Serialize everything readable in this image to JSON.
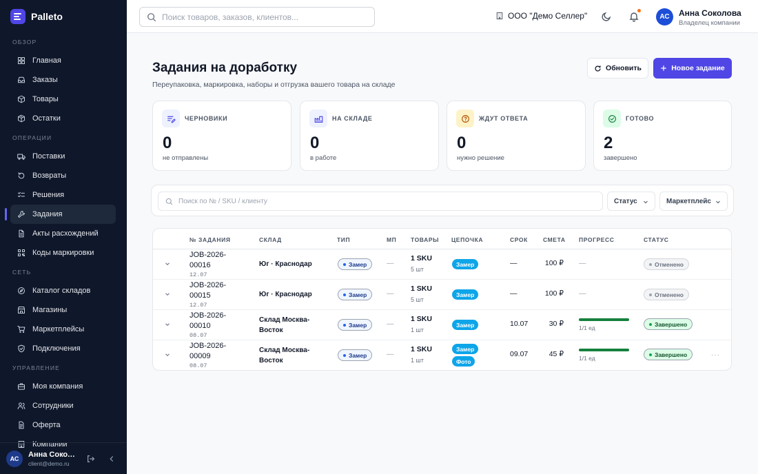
{
  "app": {
    "name": "Palleto"
  },
  "sidebar": {
    "sections": [
      {
        "title": "ОБЗОР",
        "items": [
          {
            "label": "Главная",
            "icon": "grid-icon"
          },
          {
            "label": "Заказы",
            "icon": "inbox-icon"
          },
          {
            "label": "Товары",
            "icon": "box-icon"
          },
          {
            "label": "Остатки",
            "icon": "stock-icon"
          }
        ]
      },
      {
        "title": "ОПЕРАЦИИ",
        "items": [
          {
            "label": "Поставки",
            "icon": "truck-icon"
          },
          {
            "label": "Возвраты",
            "icon": "return-icon"
          },
          {
            "label": "Решения",
            "icon": "checklist-icon"
          },
          {
            "label": "Задания",
            "icon": "wrench-icon",
            "active": true
          },
          {
            "label": "Акты расхождений",
            "icon": "file-icon"
          },
          {
            "label": "Коды маркировки",
            "icon": "qr-icon"
          }
        ]
      },
      {
        "title": "СЕТЬ",
        "items": [
          {
            "label": "Каталог складов",
            "icon": "compass-icon"
          },
          {
            "label": "Магазины",
            "icon": "store-icon"
          },
          {
            "label": "Маркетплейсы",
            "icon": "cart-icon"
          },
          {
            "label": "Подключения",
            "icon": "shield-icon"
          }
        ]
      },
      {
        "title": "УПРАВЛЕНИЕ",
        "items": [
          {
            "label": "Моя компания",
            "icon": "briefcase-icon"
          },
          {
            "label": "Сотрудники",
            "icon": "users-icon"
          },
          {
            "label": "Оферта",
            "icon": "document-icon"
          },
          {
            "label": "Компании",
            "icon": "building-icon"
          }
        ]
      }
    ],
    "footer": {
      "initials": "АС",
      "name": "Анна Соколова",
      "email": "client@demo.ru"
    }
  },
  "header": {
    "search_placeholder": "Поиск товаров, заказов, клиентов...",
    "company": "ООО \"Демо Селлер\"",
    "user": {
      "initials": "АС",
      "name": "Анна Соколова",
      "role": "Владелец компании"
    }
  },
  "page": {
    "title": "Задания на доработку",
    "subtitle": "Переупаковка, маркировка, наборы и отгрузка вашего товара на складе",
    "refresh_label": "Обновить",
    "new_label": "Новое задание"
  },
  "stats": [
    {
      "label": "ЧЕРНОВИКИ",
      "value": "0",
      "sub": "не отправлены",
      "icon": "draft-icon",
      "color": "#eef2ff",
      "accent": "#4f46e5"
    },
    {
      "label": "НА СКЛАДЕ",
      "value": "0",
      "sub": "в работе",
      "icon": "factory-icon",
      "color": "#eef2ff",
      "accent": "#4f46e5"
    },
    {
      "label": "ЖДУТ ОТВЕТА",
      "value": "0",
      "sub": "нужно решение",
      "icon": "question-icon",
      "color": "#fef3c7",
      "accent": "#b45309"
    },
    {
      "label": "ГОТОВО",
      "value": "2",
      "sub": "завершено",
      "icon": "check-circle-icon",
      "color": "#dcfce7",
      "accent": "#15803d"
    }
  ],
  "filters": {
    "search_placeholder": "Поиск по № / SKU / клиенту",
    "status_label": "Статус",
    "marketplace_label": "Маркетплейс"
  },
  "table": {
    "headers": [
      "№ ЗАДАНИЯ",
      "СКЛАД",
      "ТИП",
      "МП",
      "ТОВАРЫ",
      "ЦЕПОЧКА",
      "СРОК",
      "СМЕТА",
      "ПРОГРЕСС",
      "СТАТУС"
    ],
    "rows": [
      {
        "id_line1": "JOB-2026-",
        "id_line2": "00016",
        "date": "12.07",
        "warehouse": "Юг · Краснодар",
        "type": "Замер",
        "mp": "—",
        "sku": "1 SKU",
        "qty": "5 шт",
        "chain": [
          "Замер"
        ],
        "term": "—",
        "estimate": "100 ₽",
        "progress": null,
        "progress_text": "—",
        "status": "Отменено",
        "status_kind": "cancel"
      },
      {
        "id_line1": "JOB-2026-",
        "id_line2": "00015",
        "date": "12.07",
        "warehouse": "Юг · Краснодар",
        "type": "Замер",
        "mp": "—",
        "sku": "1 SKU",
        "qty": "5 шт",
        "chain": [
          "Замер"
        ],
        "term": "—",
        "estimate": "100 ₽",
        "progress": null,
        "progress_text": "—",
        "status": "Отменено",
        "status_kind": "cancel"
      },
      {
        "id_line1": "JOB-2026-",
        "id_line2": "00010",
        "date": "08.07",
        "warehouse": "Склад Москва-Восток",
        "type": "Замер",
        "mp": "—",
        "sku": "1 SKU",
        "qty": "1 шт",
        "chain": [
          "Замер"
        ],
        "term": "10.07",
        "estimate": "30 ₽",
        "progress": 1.0,
        "progress_text": "1/1 ед",
        "status": "Завершено",
        "status_kind": "done"
      },
      {
        "id_line1": "JOB-2026-",
        "id_line2": "00009",
        "date": "08.07",
        "warehouse": "Склад Москва-Восток",
        "type": "Замер",
        "mp": "—",
        "sku": "1 SKU",
        "qty": "1 шт",
        "chain": [
          "Замер",
          "Фото"
        ],
        "term": "09.07",
        "estimate": "45 ₽",
        "progress": 1.0,
        "progress_text": "1/1 ед",
        "status": "Завершено",
        "status_kind": "done",
        "more": "···"
      }
    ]
  }
}
